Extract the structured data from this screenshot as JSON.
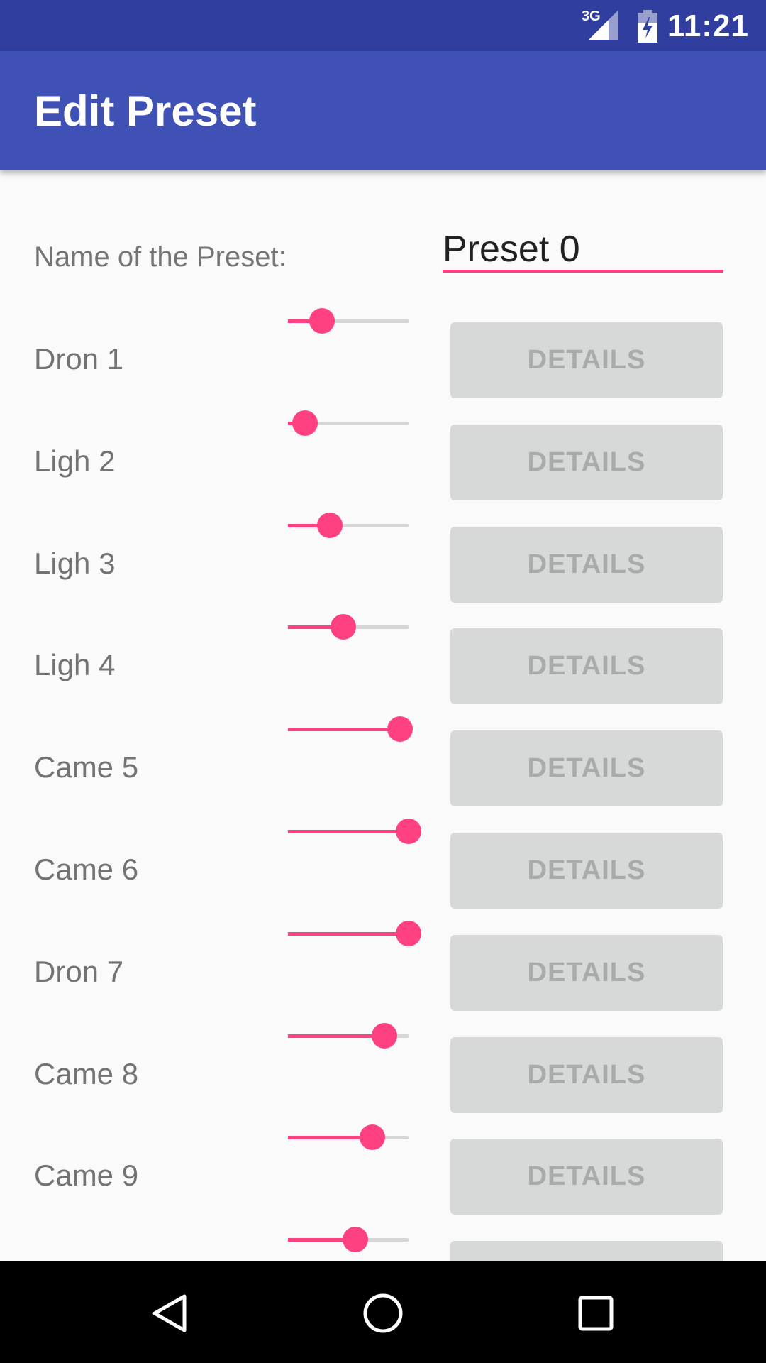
{
  "status_bar": {
    "network": "3G",
    "time": "11:21",
    "icons": [
      "signal-icon",
      "battery-charging-icon"
    ]
  },
  "app_bar": {
    "title": "Edit Preset"
  },
  "preset_name": {
    "label": "Name of the Preset:",
    "value": "Preset 0"
  },
  "rows": [
    {
      "label": "Dron 1",
      "level": 0.28,
      "button": "DETAILS"
    },
    {
      "label": "Ligh 2",
      "level": 0.14,
      "button": "DETAILS"
    },
    {
      "label": "Ligh 3",
      "level": 0.35,
      "button": "DETAILS"
    },
    {
      "label": "Ligh 4",
      "level": 0.46,
      "button": "DETAILS"
    },
    {
      "label": "Came 5",
      "level": 0.93,
      "button": "DETAILS"
    },
    {
      "label": "Came 6",
      "level": 1.0,
      "button": "DETAILS"
    },
    {
      "label": "Dron 7",
      "level": 1.0,
      "button": "DETAILS"
    },
    {
      "label": "Came 8",
      "level": 0.8,
      "button": "DETAILS"
    },
    {
      "label": "Came 9",
      "level": 0.7,
      "button": "DETAILS"
    },
    {
      "label": "",
      "level": 0.56,
      "button": ""
    }
  ],
  "nav_bar": {
    "icons": [
      "back-icon",
      "home-icon",
      "recents-icon"
    ]
  },
  "colors": {
    "primary": "#3f51b5",
    "primary_dark": "#303f9f",
    "accent": "#ff4081",
    "button_disabled": "#d7d8d8",
    "button_text_disabled": "#a9aaaa"
  }
}
